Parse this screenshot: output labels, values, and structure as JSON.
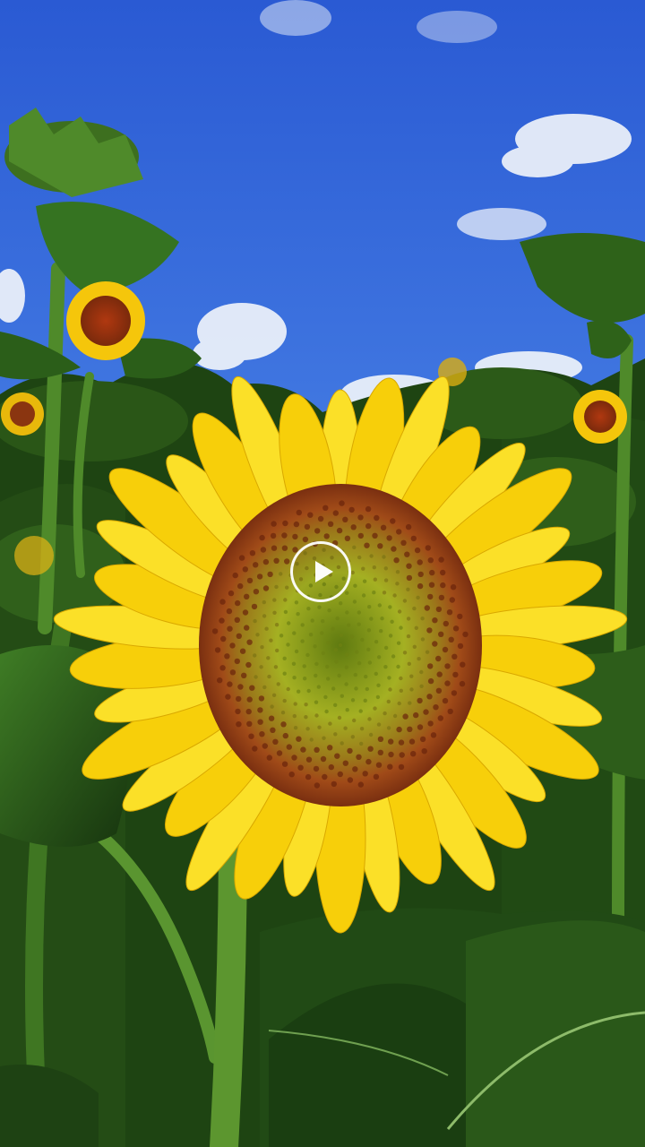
{
  "player": {
    "controls": {
      "play_icon": "play-icon"
    }
  },
  "colors": {
    "sky_top": "#2f63d8",
    "sky_bottom": "#5f98ee",
    "petal": "#f8d20a",
    "disc_outer": "#a8481b",
    "disc_center": "#9ba11a",
    "leaf_dark": "#1b3d12",
    "leaf_light": "#3e7a24"
  }
}
